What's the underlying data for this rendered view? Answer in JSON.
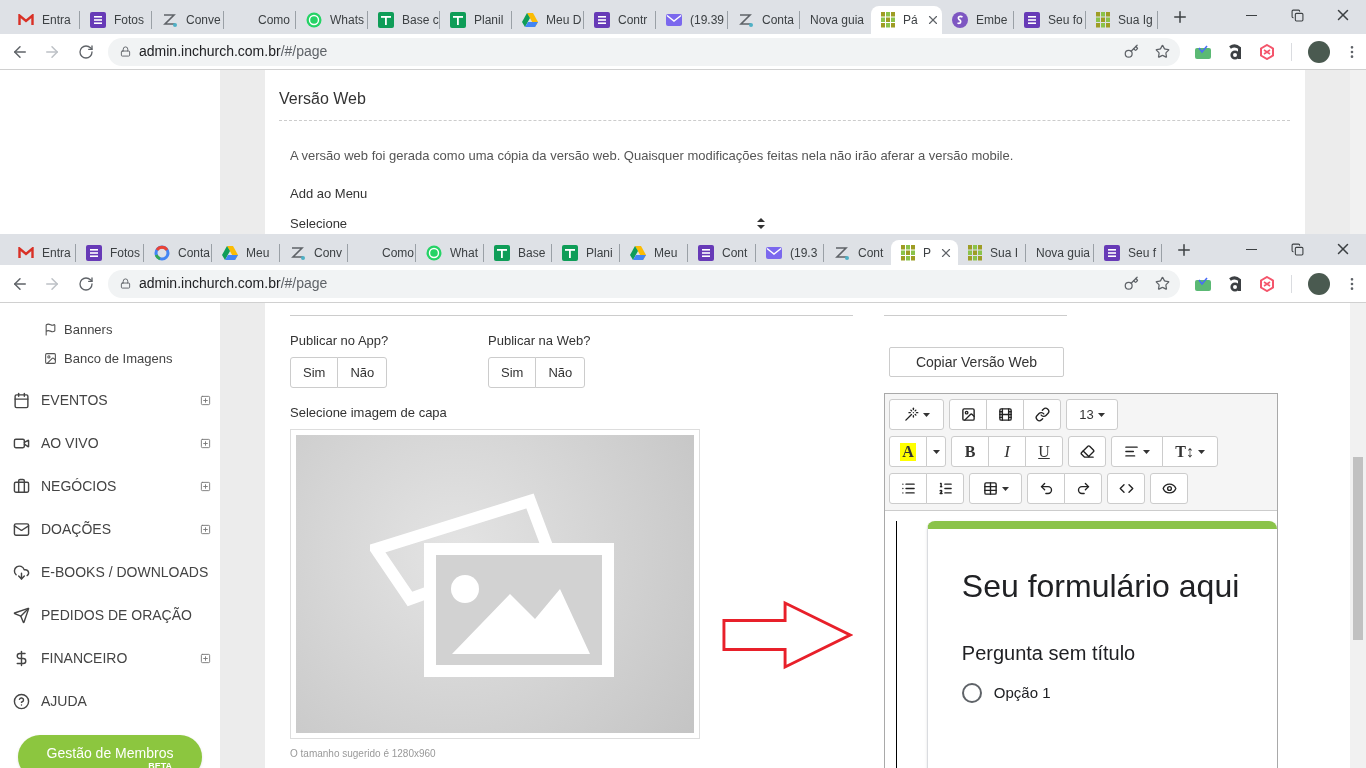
{
  "top_window": {
    "tabs": [
      {
        "title": "Entra",
        "selected": false
      },
      {
        "title": "Fotos",
        "selected": false
      },
      {
        "title": "Conve",
        "selected": false
      },
      {
        "title": "Como",
        "selected": false
      },
      {
        "title": "Whats",
        "selected": false
      },
      {
        "title": "Base c",
        "selected": false
      },
      {
        "title": "Planil",
        "selected": false
      },
      {
        "title": "Meu D",
        "selected": false
      },
      {
        "title": "Contr",
        "selected": false
      },
      {
        "title": "(19.39",
        "selected": false
      },
      {
        "title": "Conta",
        "selected": false
      },
      {
        "title": "Nova guia",
        "selected": false
      },
      {
        "title": "Pá",
        "selected": true
      },
      {
        "title": "Embe",
        "selected": false
      },
      {
        "title": "Seu fo",
        "selected": false
      },
      {
        "title": "Sua Ig",
        "selected": false
      }
    ],
    "address": {
      "host": "admin.inchurch.com.br",
      "path": "/#/page"
    },
    "section": {
      "title": "Versão Web",
      "description": "A versão web foi gerada como uma cópia da versão web. Quaisquer modificações feitas nela não irão aferar a versão mobile.",
      "menu_label": "Add ao Menu",
      "menu_value": "Selecione"
    }
  },
  "bottom_window": {
    "tabs": [
      {
        "title": "Entra",
        "selected": false
      },
      {
        "title": "Fotos",
        "selected": false
      },
      {
        "title": "Conta",
        "selected": false
      },
      {
        "title": "Meu",
        "selected": false
      },
      {
        "title": "Conv",
        "selected": false
      },
      {
        "title": "Como",
        "selected": false
      },
      {
        "title": "What",
        "selected": false
      },
      {
        "title": "Base",
        "selected": false
      },
      {
        "title": "Plani",
        "selected": false
      },
      {
        "title": "Meu",
        "selected": false
      },
      {
        "title": "Cont",
        "selected": false
      },
      {
        "title": "(19.3",
        "selected": false
      },
      {
        "title": "Cont",
        "selected": false
      },
      {
        "title": "P",
        "selected": true
      },
      {
        "title": "Sua I",
        "selected": false
      },
      {
        "title": "Nova guia",
        "selected": false
      },
      {
        "title": "Seu f",
        "selected": false
      }
    ],
    "address": {
      "host": "admin.inchurch.com.br",
      "path": "/#/page"
    },
    "sidebar": {
      "sub_items": [
        {
          "label": "Banners"
        },
        {
          "label": "Banco de Imagens"
        }
      ],
      "items": [
        {
          "label": "EVENTOS",
          "expandable": true
        },
        {
          "label": "AO VIVO",
          "expandable": true
        },
        {
          "label": "NEGÓCIOS",
          "expandable": true
        },
        {
          "label": "DOAÇÕES",
          "expandable": true
        },
        {
          "label": "E-BOOKS / DOWNLOADS",
          "expandable": false
        },
        {
          "label": "PEDIDOS DE ORAÇÃO",
          "expandable": false
        },
        {
          "label": "FINANCEIRO",
          "expandable": true
        },
        {
          "label": "AJUDA",
          "expandable": false
        }
      ],
      "members_button": {
        "label": "Gestão de Membros",
        "badge": "BETA"
      }
    },
    "form": {
      "publish_app": {
        "label": "Publicar no App?",
        "options": [
          {
            "label": "Sim",
            "selected": false
          },
          {
            "label": "Não",
            "selected": false
          }
        ]
      },
      "publish_web": {
        "label": "Publicar na Web?",
        "options": [
          {
            "label": "Sim",
            "selected": false
          },
          {
            "label": "Não",
            "selected": false
          }
        ]
      },
      "cover_label": "Selecione imagem de capa",
      "cover_hint": "O tamanho sugerido é 1280x960"
    },
    "editor": {
      "copy_button": "Copiar Versão Web",
      "toolbar": [
        [
          [
            {
              "kind": "icon",
              "caret": true
            }
          ],
          [
            {
              "kind": "icon",
              "caret": false
            },
            {
              "kind": "icon",
              "caret": false
            },
            {
              "kind": "icon",
              "caret": false
            }
          ],
          [
            {
              "kind": "text",
              "label": "13",
              "caret": true
            }
          ]
        ],
        [
          [
            {
              "kind": "highlight",
              "label": "A",
              "caret": false
            },
            {
              "kind": "icon",
              "caret": true
            }
          ],
          [
            {
              "kind": "bold",
              "label": "B",
              "caret": false
            },
            {
              "kind": "italic",
              "label": "I",
              "caret": false
            },
            {
              "kind": "underline",
              "label": "U",
              "caret": false
            }
          ],
          [
            {
              "kind": "icon",
              "caret": false
            }
          ],
          [
            {
              "kind": "icon",
              "caret": true
            },
            {
              "kind": "bold",
              "label": "T↕",
              "caret": true
            }
          ]
        ],
        [
          [
            {
              "kind": "icon",
              "caret": false
            },
            {
              "kind": "icon",
              "caret": false
            }
          ],
          [
            {
              "kind": "icon",
              "caret": true
            }
          ],
          [
            {
              "kind": "icon",
              "caret": false
            },
            {
              "kind": "icon",
              "caret": false
            }
          ],
          [
            {
              "kind": "icon",
              "caret": false
            }
          ],
          [
            {
              "kind": "icon",
              "caret": false
            }
          ]
        ]
      ],
      "embed": {
        "title": "Seu formulário aqui",
        "question": "Pergunta sem título",
        "options": [
          {
            "label": "Opção 1",
            "selected": false
          }
        ]
      }
    }
  }
}
